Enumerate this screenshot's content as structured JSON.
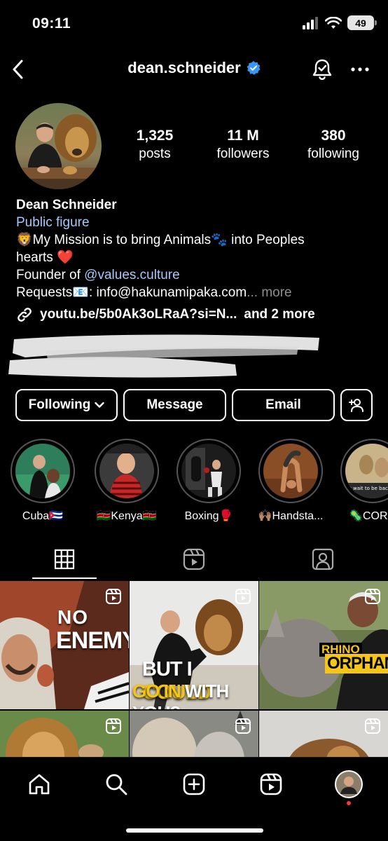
{
  "status": {
    "time": "09:11",
    "battery": "49"
  },
  "header": {
    "username": "dean.schneider"
  },
  "stats": [
    {
      "value": "1,325",
      "label": "posts"
    },
    {
      "value": "11 M",
      "label": "followers"
    },
    {
      "value": "380",
      "label": "following"
    }
  ],
  "bio": {
    "name": "Dean Schneider",
    "category": "Public figure",
    "line1_emoji": "🦁",
    "line1": "My Mission is to bring Animals",
    "line1_emoji2": "🐾",
    "line1_end": " into Peoples",
    "line2": "hearts",
    "line2_emoji": "❤️",
    "founder_prefix": "Founder of ",
    "founder_link": "@values.culture",
    "requests_prefix": "Requests",
    "requests_emoji": "📧",
    "requests_text": ": info@hakunamipaka.com",
    "more": "... more",
    "url": "youtu.be/5b0Ak3oLRaA?si=N...",
    "url_more": "and 2 more"
  },
  "actions": {
    "following": "Following",
    "message": "Message",
    "email": "Email"
  },
  "highlights": [
    {
      "label": "Cuba🇨🇺"
    },
    {
      "label": "🇰🇪Kenya🇰🇪"
    },
    {
      "label": "Boxing🥊"
    },
    {
      "label": "🙌🏽Handsta..."
    },
    {
      "label": "🦠CORO"
    }
  ],
  "grid": {
    "post1": {
      "line1": "NO",
      "line2": "ENEMY"
    },
    "post2": {
      "line1a": "BUT I ",
      "line1b": "COULD",
      "line2a": "GO IN",
      "line2b": " WITH YOU?"
    },
    "post3": {
      "line1": "RHINO",
      "line2": "ORPHAN!"
    },
    "post5_text": "t wait to be back"
  },
  "colors": {
    "link": "#a8c7fa",
    "verified": "#3897f0",
    "accent_yellow": "#f5c518",
    "notification_dot": "#ff3040"
  }
}
